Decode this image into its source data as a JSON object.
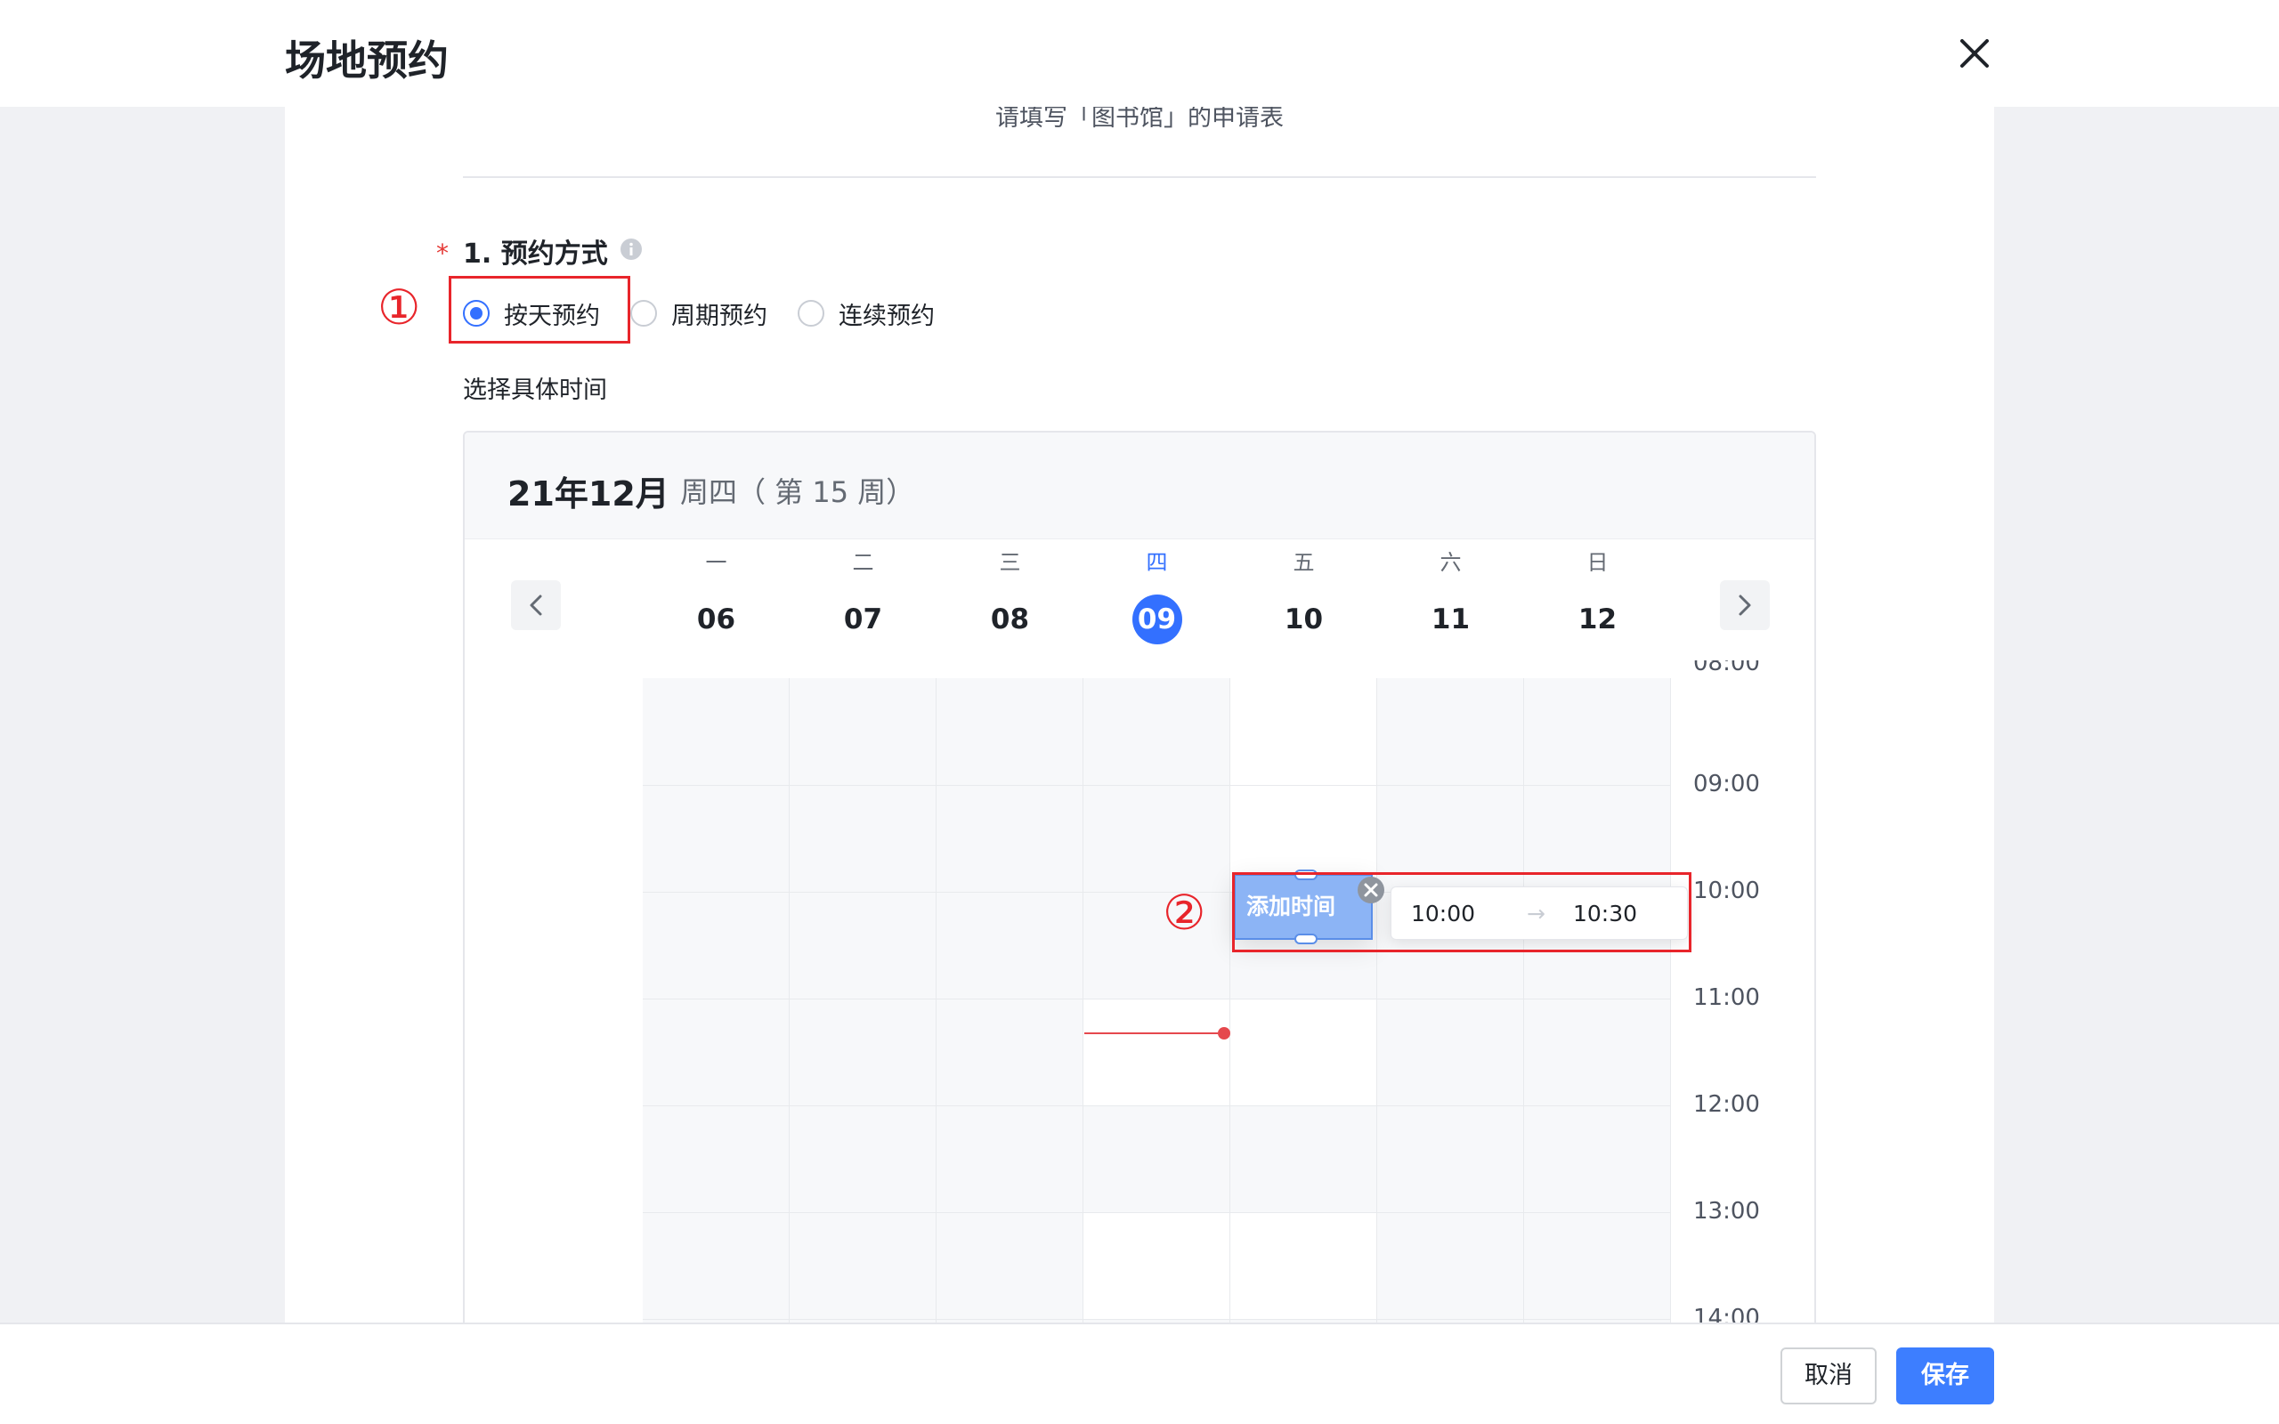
{
  "dialog": {
    "title": "场地预约",
    "close_icon": "close-icon"
  },
  "form": {
    "subtitle": "请填写「图书馆」的申请表",
    "question": {
      "required_mark": "*",
      "label": "1. 预约方式",
      "info_icon": "info-icon"
    },
    "modes": [
      {
        "label": "按天预约",
        "checked": true
      },
      {
        "label": "周期预约",
        "checked": false
      },
      {
        "label": "连续预约",
        "checked": false
      }
    ],
    "time_section_label": "选择具体时间"
  },
  "calendar": {
    "year_month": "21年12月",
    "week_info": "周四（ 第 15 周）",
    "days": [
      {
        "weekday": "一",
        "date": "06"
      },
      {
        "weekday": "二",
        "date": "07"
      },
      {
        "weekday": "三",
        "date": "08"
      },
      {
        "weekday": "四",
        "date": "09",
        "today": true
      },
      {
        "weekday": "五",
        "date": "10"
      },
      {
        "weekday": "六",
        "date": "11"
      },
      {
        "weekday": "日",
        "date": "12"
      }
    ],
    "hours": [
      "08:00",
      "09:00",
      "10:00",
      "11:00",
      "12:00",
      "13:00",
      "14:00"
    ],
    "event": {
      "label": "添加时间",
      "start": "10:00",
      "end": "10:30",
      "arrow": "→"
    }
  },
  "annotations": {
    "one": "①",
    "two": "②"
  },
  "footer": {
    "cancel_label": "取消",
    "save_label": "保存"
  },
  "colors": {
    "accent": "#3370ff",
    "annotation_red": "#e8252b",
    "now_line": "#e5484d",
    "event_fill": "#8cb4f5"
  }
}
